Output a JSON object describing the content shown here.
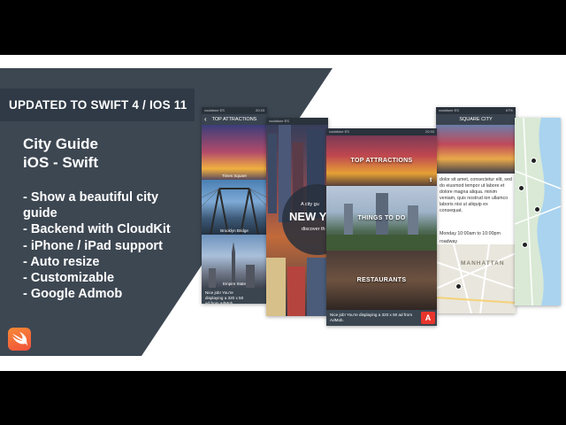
{
  "banner": {
    "badge": "UPDATED TO SWIFT  4 / IOS 11",
    "title_line1": "City Guide",
    "title_line2": "iOS - Swift",
    "features": [
      "- Show a beautiful city guide",
      "- Backend with CloudKit",
      "- iPhone / iPad support",
      "- Auto resize",
      "- Customizable",
      "- Google Admob"
    ]
  },
  "colors": {
    "slate": "#3d4752",
    "badge": "#2f3a46",
    "swift_orange": "#f58a33",
    "ad_red": "#e8352c"
  },
  "icons": [
    "swift-logo-icon",
    "back-chevron-icon",
    "share-icon",
    "ad-app-icon",
    "map-pin-icon"
  ],
  "phones": {
    "status": {
      "carrier": "vodafone ES",
      "time": "20:33",
      "battery": "67%"
    },
    "list": {
      "nav_title": "TOP ATTRACTIONS",
      "items": [
        "Times Square",
        "Brooklyn Bridge",
        "Empire State"
      ],
      "ad_text": "Nice job! You're displaying a 320 x 50 ad from AdMob."
    },
    "home": {
      "small_text": "A city gu",
      "city": "NEW Y",
      "discover": "discover th"
    },
    "sections": {
      "items": [
        "TOP ATTRACTIONS",
        "THINGS TO DO",
        "RESTAURANTS"
      ],
      "ad_text": "Nice job! You're displaying a 320 x 50 ad from AdMob."
    },
    "detail": {
      "nav_title": "SQUARE CITY",
      "body": "dolor sit amet, consectetur elit, sed do eiusmod tempor ut labore et dolore magna aliqua. minim veniam, quis nostrud ion ullamco laboris nisi ut aliquip ex consequat.",
      "hours": "Monday 10:00am to 10:00pm",
      "address": "roadway",
      "map_label": "MANHATTAN"
    }
  }
}
